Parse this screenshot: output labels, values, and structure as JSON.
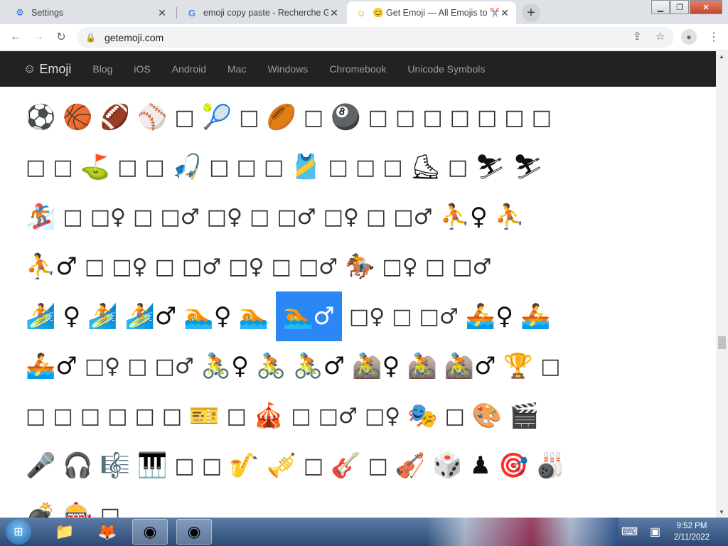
{
  "browser": {
    "tabs": [
      {
        "title": "Settings",
        "icon": "gear-icon",
        "active": false
      },
      {
        "title": "emoji copy paste - Recherche Go",
        "icon": "google-icon",
        "active": false
      },
      {
        "title": "😊 Get Emoji — All Emojis to ✂️ C",
        "icon": "smiley-icon",
        "active": true
      }
    ],
    "url": "getemoji.com",
    "window_controls": [
      "minimize",
      "restore",
      "close"
    ]
  },
  "site": {
    "brand": "Emoji",
    "nav": [
      "Blog",
      "iOS",
      "Android",
      "Mac",
      "Windows",
      "Chromebook",
      "Unicode Symbols"
    ]
  },
  "emoji_rows": [
    [
      "⚽",
      "🏀",
      "🏈",
      "⚾",
      "□",
      "🎾",
      "□",
      "🏉",
      "□",
      "🎱",
      "□",
      "□",
      "□",
      "□",
      "□",
      "□",
      "□"
    ],
    [
      "□",
      "□",
      "⛳",
      "□",
      "□",
      "🎣",
      "□",
      "□",
      "□",
      "🎽",
      "□",
      "□",
      "□",
      "⛸",
      "□",
      "⛷",
      "⛷"
    ],
    [
      "🏂",
      "□",
      "□♀",
      "□",
      "□♂",
      "□♀",
      "□",
      "□♂",
      "□♀",
      "□",
      "□♂",
      "⛹♀",
      "⛹"
    ],
    [
      "⛹♂",
      "□",
      "□♀",
      "□",
      "□♂",
      "□♀",
      "□",
      "□♂",
      "🏇",
      "□♀",
      "□",
      "□♂"
    ],
    [
      "🏄",
      "♀",
      "🏄",
      "🏄♂",
      "🏊♀",
      "🏊",
      "🏊♂",
      "□♀",
      "□",
      "□♂",
      "🚣♀",
      "🚣"
    ],
    [
      "🚣♂",
      "□♀",
      "□",
      "□♂",
      "🚴♀",
      "🚴",
      "🚴♂",
      "🚵♀",
      "🚵",
      "🚵♂",
      "🏆",
      "□"
    ],
    [
      "□",
      "□",
      "□",
      "□",
      "□",
      "□",
      "🎫",
      "□",
      "🎪",
      "□",
      "□♂",
      "□♀",
      "🎭",
      "□",
      "🎨",
      "🎬"
    ],
    [
      "🎤",
      "🎧",
      "🎼",
      "🎹",
      "□",
      "□",
      "🎷",
      "🎺",
      "□",
      "🎸",
      "□",
      "🎻",
      "🎲",
      "♟",
      "🎯",
      "🎳"
    ],
    [
      "💣",
      "🎰",
      "□"
    ]
  ],
  "selected_emoji": "🏊♂",
  "taskbar": {
    "items": [
      "explorer",
      "firefox",
      "chrome",
      "chrome"
    ],
    "time": "9:52 PM",
    "date": "2/11/2022"
  }
}
